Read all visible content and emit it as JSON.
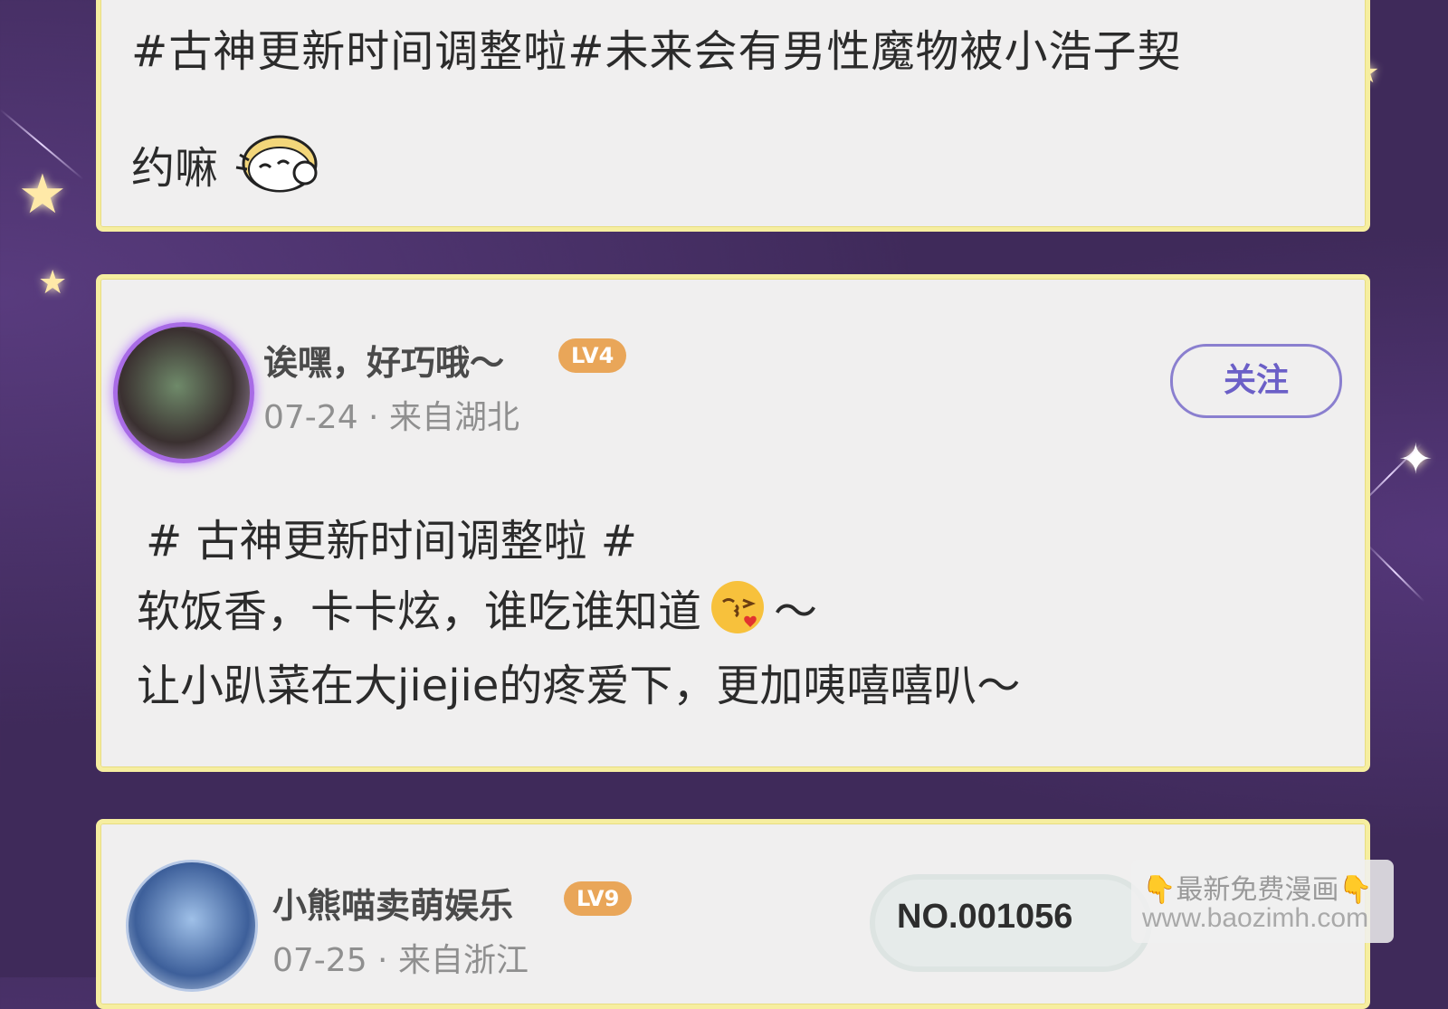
{
  "posts": [
    {
      "text_line1": "#古神更新时间调整啦#未来会有男性魔物被小浩子契",
      "text_line2": "约嘛",
      "sticker_icon": "cartoon-face-sticker"
    },
    {
      "username": "诶嘿，好巧哦～",
      "level": "LV4",
      "meta": "07-24 · 来自湖北",
      "follow_label": "关注",
      "body_line1": "# 古神更新时间调整啦 #",
      "body_line2_a": "软饭香，卡卡炫，谁吃谁知道",
      "body_line2_b": "～",
      "body_line3": "让小趴菜在大jiejie的疼爱下，更加咦嘻嘻叭～",
      "emoji_icon": "kiss-emoji"
    },
    {
      "username": "小熊喵卖萌娱乐",
      "level": "LV9",
      "meta": "07-25 · 来自浙江",
      "number_badge": "NO.001056"
    }
  ],
  "watermark": {
    "line1": "👇最新免费漫画👇",
    "line2": "www.baozimh.com"
  },
  "colors": {
    "background": "#3f2a5a",
    "card": "#f0efef",
    "card_border": "#f6eea0",
    "level_badge": "#e9a659",
    "follow_accent": "#6b5fc7"
  }
}
